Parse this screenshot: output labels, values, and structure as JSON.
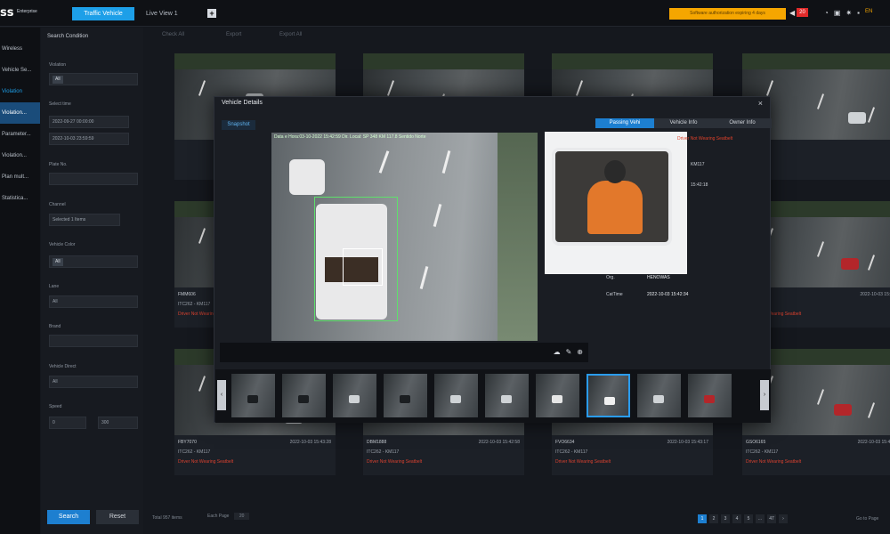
{
  "topbar": {
    "logo": "ss",
    "logo_sub": "Enterprise",
    "tabs": [
      {
        "label": "Traffic Vehicle",
        "active": true
      },
      {
        "label": "Live View 1",
        "active": false
      }
    ],
    "notice": "Software authorization expiring 4 days",
    "alarm_count": "20",
    "user_label": "EN"
  },
  "nav": {
    "items": [
      {
        "label": "Wireless"
      },
      {
        "label": "Vehicle Se..."
      },
      {
        "label": "Violation"
      },
      {
        "label": "Violation..."
      },
      {
        "label": "Parameter..."
      },
      {
        "label": "Violation..."
      },
      {
        "label": "Plan mult..."
      },
      {
        "label": "Statistica..."
      }
    ]
  },
  "search": {
    "title": "Search Condition",
    "violation_label": "Violation",
    "violation_value": "All",
    "time_label": "Select time",
    "time_start": "2022-09-27 00:00:00",
    "time_end": "2022-10-03 23:59:59",
    "plate_label": "Plate No.",
    "channel_label": "Channel",
    "channel_value": "Selected 1 Items",
    "color_label": "Vehicle Color",
    "color_value": "All",
    "lane_label": "Lane",
    "lane_value": "All",
    "brand_label": "Brand",
    "direct_label": "Vehicle Direct",
    "direct_value": "All",
    "speed_label": "Speed",
    "speed_min": "0",
    "speed_max": "300",
    "search_btn": "Search",
    "reset_btn": "Reset"
  },
  "toolbar": {
    "check_all": "Check All",
    "export": "Export",
    "export_all": "Export All"
  },
  "cards": [
    {
      "plate": "",
      "time": "",
      "loc": "",
      "event": ""
    },
    {
      "plate": "",
      "time": "",
      "loc": "",
      "event": ""
    },
    {
      "plate": "",
      "time": "",
      "loc": "",
      "event": ""
    },
    {
      "plate": "",
      "time": "",
      "loc": "",
      "event": ""
    },
    {
      "plate": "FMM606",
      "time": "",
      "loc": "ITC262 - KM117",
      "event": "Driver Not Wearing Seatbelt"
    },
    {
      "plate": "",
      "time": "2022-10-03 15:43:1",
      "loc": "KM117",
      "event": "Driver Not Wearing Seatbelt"
    },
    {
      "plate": "FLC3293",
      "time": "",
      "loc": "ITC262 - KM117",
      "event": "Driver Not Wearing Seatbelt"
    },
    {
      "plate": "",
      "time": "2022-10-03 15:42:5",
      "loc": "KM117",
      "event": "Driver Not Wearing Seatbelt"
    },
    {
      "plate": "FBY7070",
      "time": "2022-10-03 15:43:28",
      "loc": "ITC262 - KM117",
      "event": "Driver Not Wearing Seatbelt"
    },
    {
      "plate": "DBM1888",
      "time": "2022-10-03 15:42:58",
      "loc": "ITC262 - KM117",
      "event": "Driver Not Wearing Seatbelt"
    },
    {
      "plate": "FVO6634",
      "time": "2022-10-03 15:43:17",
      "loc": "ITC262 - KM117",
      "event": "Driver Not Wearing Seatbelt"
    },
    {
      "plate": "GSO6165",
      "time": "2022-10-03 15:42:48",
      "loc": "ITC262 - KM117",
      "event": "Driver Not Wearing Seatbelt"
    }
  ],
  "footer": {
    "total": "Total 957 items",
    "per_page_label": "Each Page",
    "per_page_value": "20",
    "pages": [
      "1",
      "2",
      "3",
      "4",
      "5",
      "...",
      "47"
    ],
    "goto": "Go to Page"
  },
  "modal": {
    "title": "Vehicle Details",
    "close": "×",
    "snapshot_tab": "Snapshot",
    "tabs": [
      {
        "label": "Passing Vehi",
        "active": true
      },
      {
        "label": "Vehicle Info",
        "active": false
      },
      {
        "label": "Owner Info",
        "active": false
      }
    ],
    "overlay_text": "Data e Hora:03-10-2022 15:42:59 Dir. Local: SP 348 KM 117.8 Sentido Norte",
    "event": "Driver Not Wearing Seatbelt",
    "info": [
      {
        "label": "",
        "value": "KM117"
      },
      {
        "label": "",
        "value": "15:42:18"
      }
    ],
    "org_label": "Org.",
    "org_value": "HENOWAS",
    "captime_label": "CatTime",
    "captime_value": "2022-10-03 15:42:34"
  },
  "strip": {
    "count": 10,
    "selected_index": 7
  }
}
